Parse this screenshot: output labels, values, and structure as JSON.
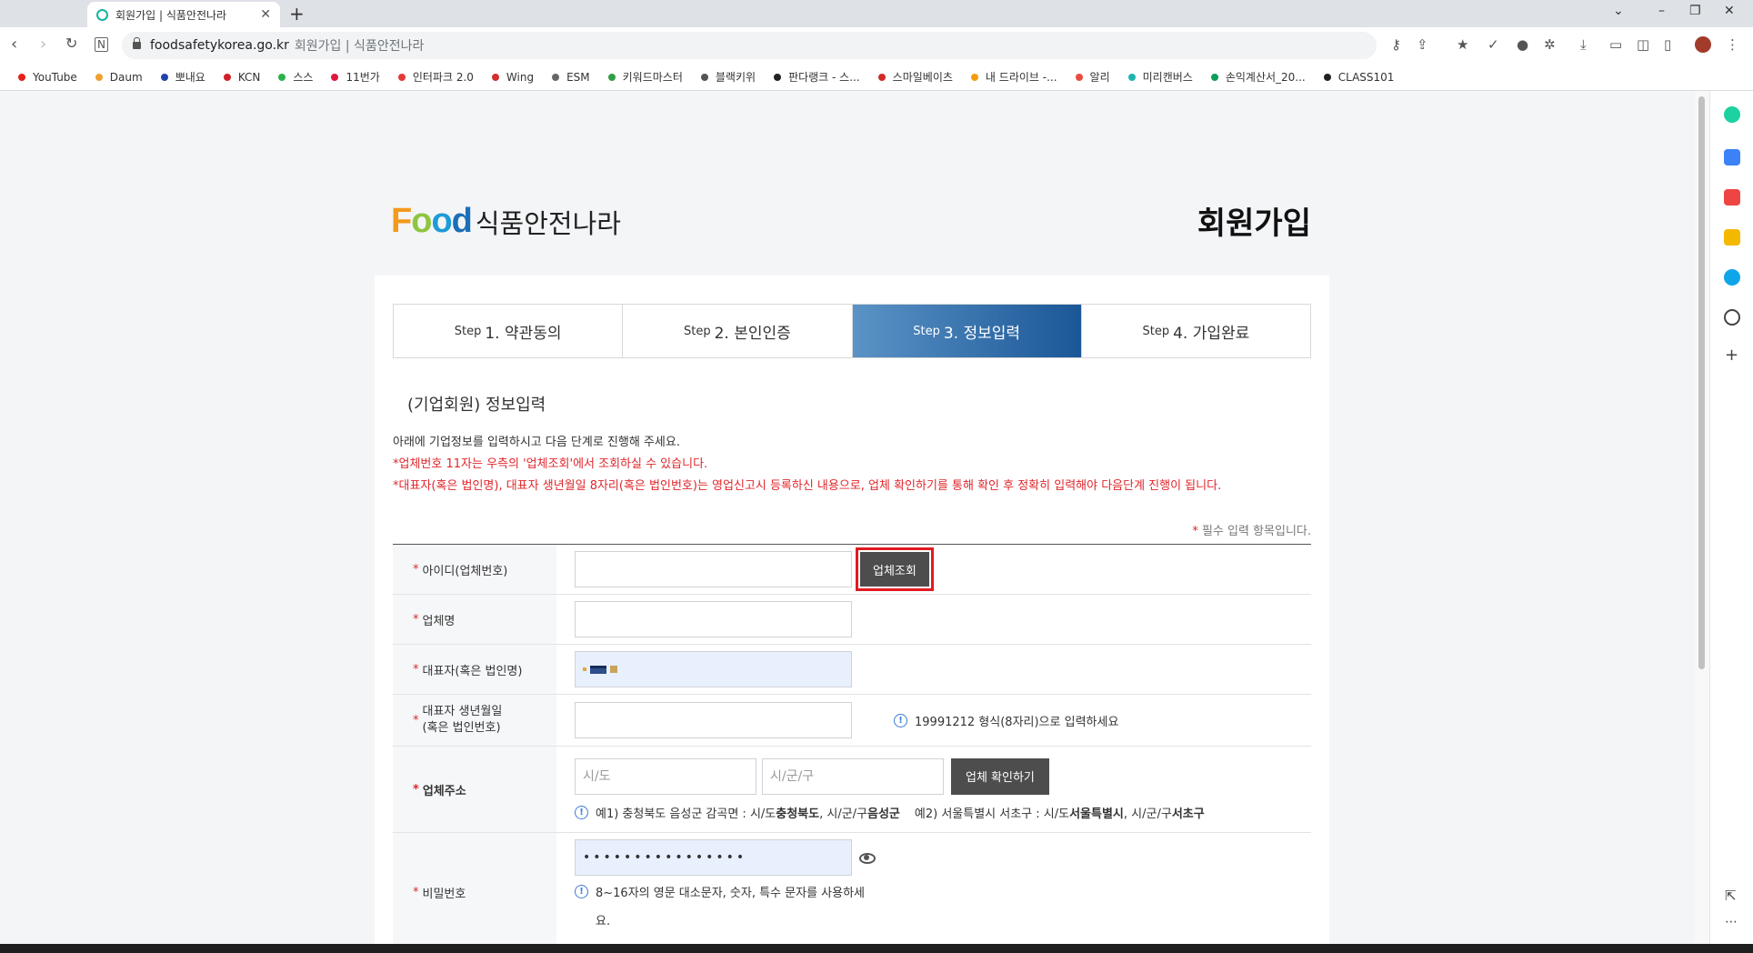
{
  "browser": {
    "tab_title": "회원가입 | 식품안전나라",
    "url_domain": "foodsafetykorea.go.kr",
    "url_rest": "회원가입 | 식품안전나라"
  },
  "bookmarks": [
    {
      "label": "YouTube",
      "color": "#e62117"
    },
    {
      "label": "Daum",
      "color": "#f0a030"
    },
    {
      "label": "뽀내요",
      "color": "#2244aa"
    },
    {
      "label": "KCN",
      "color": "#d21f2a"
    },
    {
      "label": "스스",
      "color": "#2bb24c"
    },
    {
      "label": "11번가",
      "color": "#e0193f"
    },
    {
      "label": "인터파크 2.0",
      "color": "#e03a3a"
    },
    {
      "label": "Wing",
      "color": "#d32f2f"
    },
    {
      "label": "ESM",
      "color": "#666666"
    },
    {
      "label": "키워드마스터",
      "color": "#2ea043"
    },
    {
      "label": "블랙키위",
      "color": "#555555"
    },
    {
      "label": "판다랭크 - 스...",
      "color": "#222222"
    },
    {
      "label": "스마일베이츠",
      "color": "#d12a2a"
    },
    {
      "label": "내 드라이브 -...",
      "color": "#f39c12"
    },
    {
      "label": "알리",
      "color": "#e74c3c"
    },
    {
      "label": "미리캔버스",
      "color": "#1eb5b0"
    },
    {
      "label": "손익계산서_20...",
      "color": "#0f9d58"
    },
    {
      "label": "CLASS101",
      "color": "#222222"
    }
  ],
  "header": {
    "logo_food": "Food",
    "logo_kr": "식품안전나라",
    "page_title": "회원가입"
  },
  "steps": [
    {
      "prefix": "Step",
      "label": "1. 약관동의",
      "active": false
    },
    {
      "prefix": "Step",
      "label": "2. 본인인증",
      "active": false
    },
    {
      "prefix": "Step",
      "label": "3. 정보입력",
      "active": true
    },
    {
      "prefix": "Step",
      "label": "4. 가입완료",
      "active": false
    }
  ],
  "section": {
    "title": "(기업회원) 정보입력",
    "info1": "아래에 기업정보를 입력하시고 다음 단계로 진행해 주세요.",
    "info2": "*업체번호 11자는 우측의 '업체조회'에서 조회하실 수 있습니다.",
    "info3": "*대표자(혹은 법인명), 대표자 생년월일 8자리(혹은 법인번호)는 영업신고시 등록하신 내용으로, 업체 확인하기를 통해 확인 후 정확히 입력해야 다음단계 진행이 됩니다.",
    "req_star": "*",
    "req_note": "필수 입력 항목입니다."
  },
  "form": {
    "star": "*",
    "id_label": "아이디(업체번호)",
    "id_value": "",
    "lookup_button": "업체조회",
    "company_label": "업체명",
    "company_value": "",
    "rep_label": "대표자(혹은 법인명)",
    "birth_label_1": "대표자 생년월일",
    "birth_label_2": "(혹은 법인번호)",
    "birth_value": "",
    "birth_hint": "19991212 형식(8자리)으로 입력하세요",
    "addr_label": "업체주소",
    "addr_city_placeholder": "시/도",
    "addr_district_placeholder": "시/군/구",
    "verify_button": "업체 확인하기",
    "addr_hint_1": "예1) 충청북도 음성군 감곡면 : 시/도 ",
    "addr_hint_1b": "충청북도",
    "addr_hint_1c": " , 시/군/구 ",
    "addr_hint_1d": "음성군",
    "addr_hint_2": "예2) 서울특별시 서초구 : 시/도 ",
    "addr_hint_2b": "서울특별시",
    "addr_hint_2c": " , 시/군/구 ",
    "addr_hint_2d": "서초구",
    "pw_label": "비밀번호",
    "pw_value": "••••••••••••••••",
    "pw_hint": "8~16자의 영문 대소문자, 숫자, 특수 문자를 사용하세",
    "pw_hint_wrap": "요."
  }
}
